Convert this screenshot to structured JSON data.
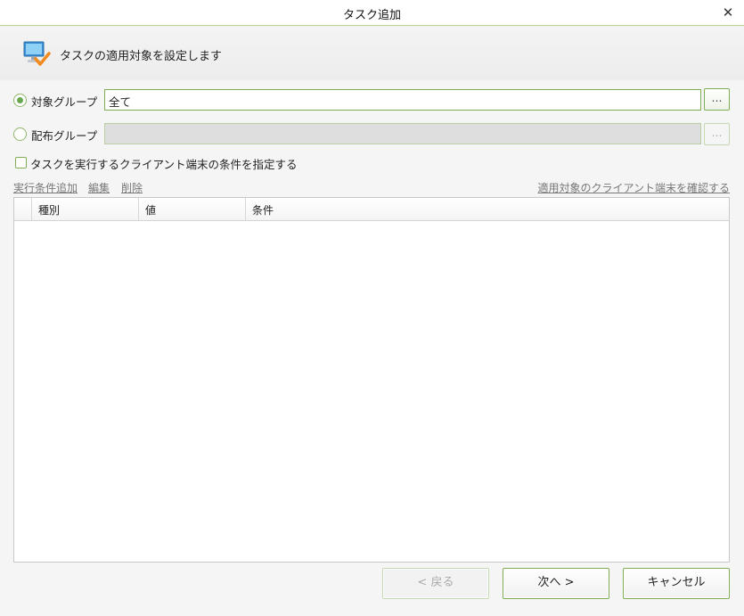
{
  "window": {
    "title": "タスク追加",
    "close_label": "✕"
  },
  "header": {
    "subtitle": "タスクの適用対象を設定します"
  },
  "target_group": {
    "label": "対象グループ",
    "value": "全て",
    "browse_label": "…",
    "selected": true
  },
  "distribution_group": {
    "label": "配布グループ",
    "value": "",
    "browse_label": "…",
    "selected": false
  },
  "condition_checkbox": {
    "label": "タスクを実行するクライアント端末の条件を指定する",
    "checked": false
  },
  "links": {
    "add_condition": "実行条件追加",
    "edit": "編集",
    "delete": "削除",
    "check_clients": "適用対象のクライアント端末を確認する"
  },
  "table": {
    "columns": [
      "種別",
      "値",
      "条件"
    ],
    "rows": []
  },
  "buttons": {
    "back": "< 戻る",
    "next": "次へ >",
    "cancel": "キャンセル"
  },
  "colors": {
    "accent": "#7fae55",
    "radio_dot": "#6aa84f"
  },
  "icons": {
    "header": "monitor-check-icon",
    "close": "close-icon"
  }
}
